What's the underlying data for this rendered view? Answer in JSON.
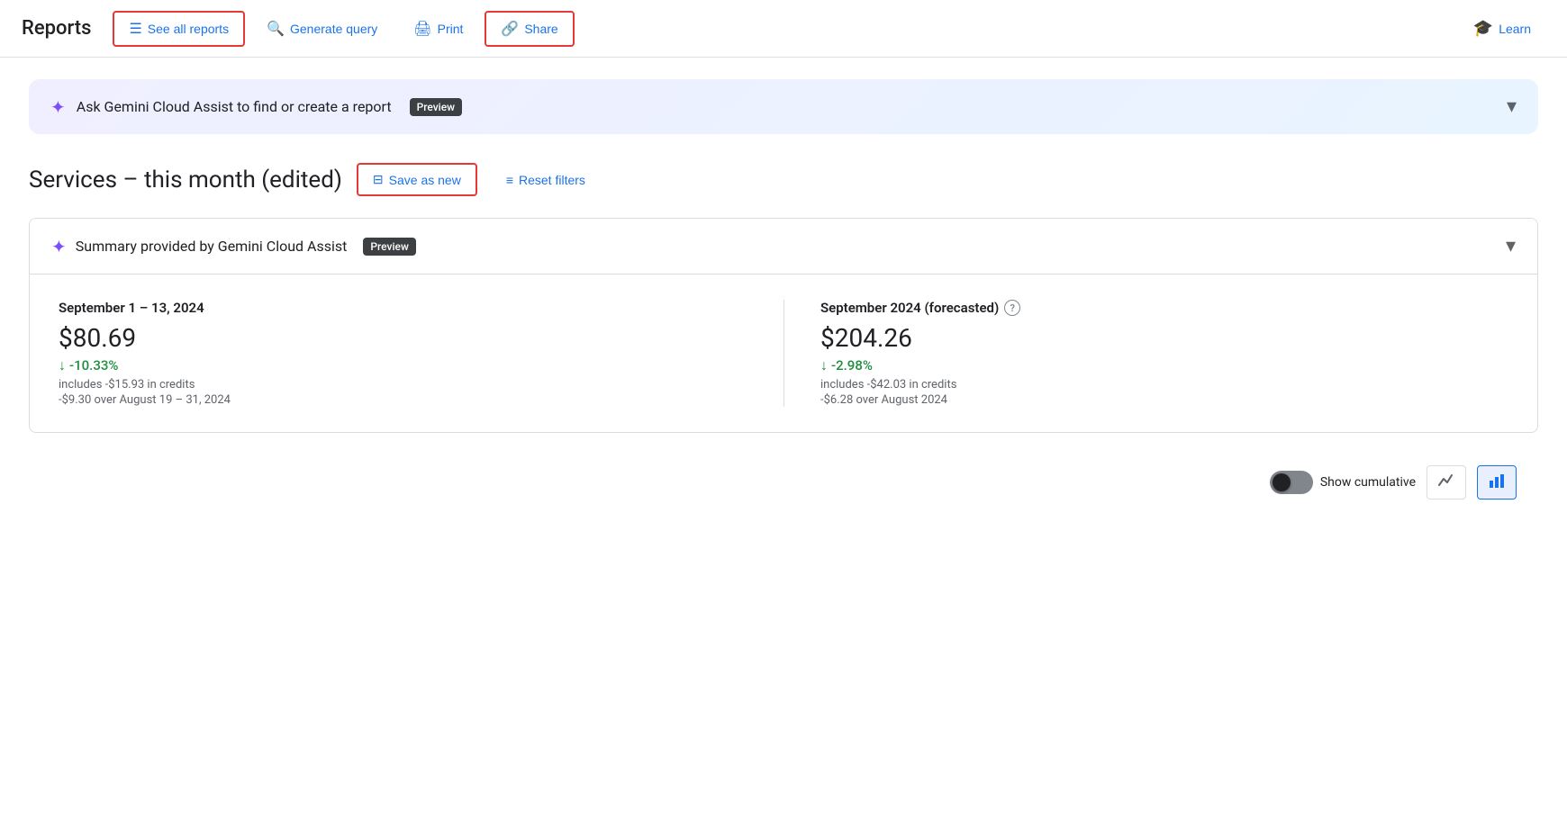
{
  "header": {
    "title": "Reports",
    "see_all_reports": "See all reports",
    "generate_query": "Generate query",
    "print": "Print",
    "share": "Share",
    "learn": "Learn"
  },
  "gemini_banner": {
    "text": "Ask Gemini Cloud Assist to find or create a report",
    "badge": "Preview"
  },
  "report": {
    "title": "Services – this month (edited)",
    "save_as_new": "Save as new",
    "reset_filters": "Reset filters"
  },
  "summary_card": {
    "header": "Summary provided by Gemini Cloud Assist",
    "badge": "Preview",
    "left": {
      "period": "September 1 – 13, 2024",
      "amount": "$80.69",
      "change_pct": "-10.33%",
      "credits": "includes -$15.93 in credits",
      "compare": "-$9.30 over August 19 – 31, 2024"
    },
    "right": {
      "period": "September 2024 (forecasted)",
      "amount": "$204.26",
      "change_pct": "-2.98%",
      "credits": "includes -$42.03 in credits",
      "compare": "-$6.28 over August 2024"
    }
  },
  "bottom_toolbar": {
    "show_cumulative": "Show cumulative"
  }
}
